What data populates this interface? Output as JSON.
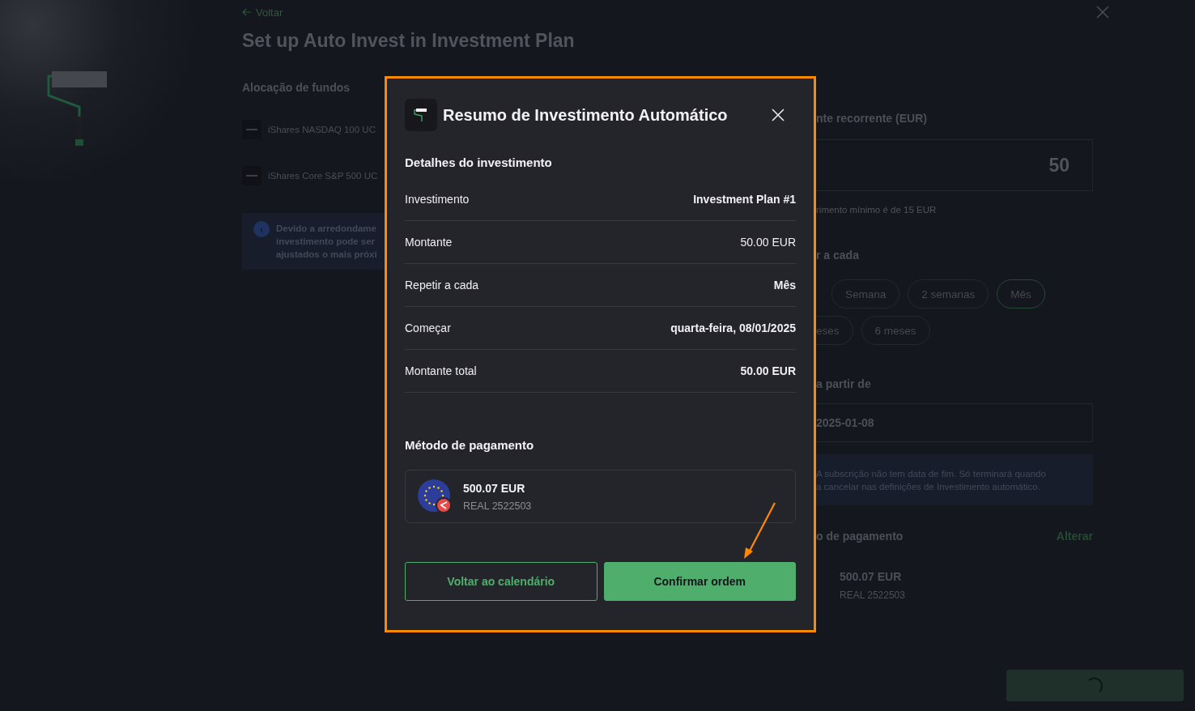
{
  "page": {
    "back_link": "Voltar",
    "title": "Set up Auto Invest in Investment Plan"
  },
  "allocation": {
    "heading": "Alocação de fundos",
    "funds": [
      {
        "name": "iShares NASDAQ 100 UC"
      },
      {
        "name": "iShares Core S&P 500 UC"
      }
    ],
    "notice": [
      "Devido a arredondame",
      "investimento pode ser",
      "ajustados o mais próxi"
    ]
  },
  "settings": {
    "amount_label": "nte recorrente (EUR)",
    "amount_value": "50",
    "amount_hint": "rimento mínimo é de 15 EUR",
    "repeat_label": "r a cada",
    "frequency_rows": [
      [
        {
          "label": "Semana",
          "selected": false
        },
        {
          "label": "2 semanas",
          "selected": false
        },
        {
          "label": "Mês",
          "selected": true
        }
      ],
      [
        {
          "label": "eses",
          "selected": false
        },
        {
          "label": "6 meses",
          "selected": false
        }
      ]
    ],
    "start_label": "a partir de",
    "start_date": "2025-01-08",
    "notice": [
      "A subscrição não tem data de fim. Só terminará quando",
      "a cancelar nas definições de Investimento automático."
    ],
    "payment_label": "o de pagamento",
    "change_link": "Alterar",
    "payment": {
      "amount": "500.07 EUR",
      "account": "REAL 2522503"
    }
  },
  "modal": {
    "title": "Resumo de Investimento Automático",
    "details_heading": "Detalhes do investimento",
    "rows": [
      {
        "label": "Investimento",
        "value": "Investment Plan #1",
        "bold": true
      },
      {
        "label": "Montante",
        "value": "50.00 EUR",
        "bold": false
      },
      {
        "label": "Repetir a cada",
        "value": "Mês",
        "bold": true
      },
      {
        "label": "Começar",
        "value": "quarta-feira, 08/01/2025",
        "bold": true
      },
      {
        "label": "Montante total",
        "value": "50.00 EUR",
        "bold": true
      }
    ],
    "payment_heading": "Método de pagamento",
    "payment": {
      "amount": "500.07 EUR",
      "account": "REAL 2522503"
    },
    "buttons": [
      {
        "label": "Voltar ao calendário",
        "kind": "secondary"
      },
      {
        "label": "Confirmar ordem",
        "kind": "primary"
      }
    ]
  }
}
